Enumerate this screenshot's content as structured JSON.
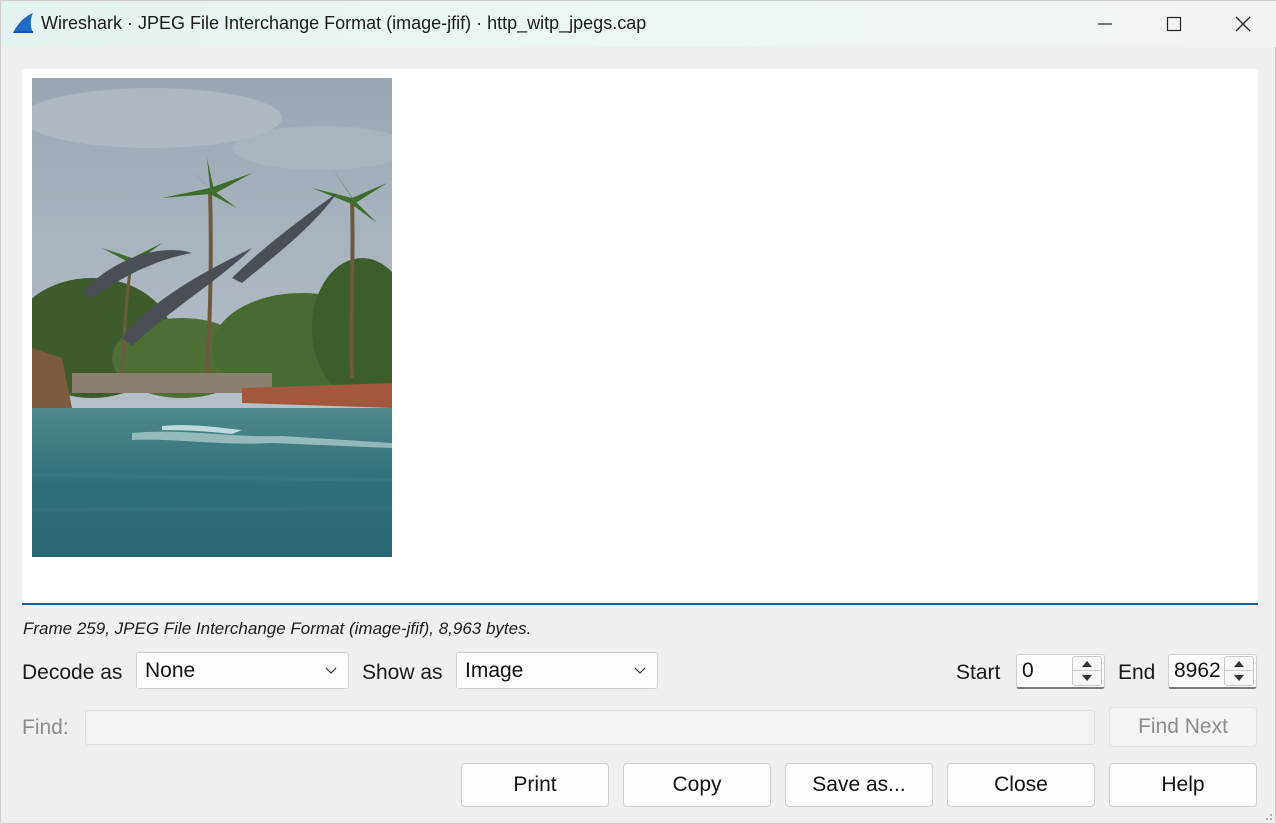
{
  "window": {
    "title": "Wireshark · JPEG File Interchange Format (image-jfif) · http_witp_jpegs.cap",
    "icon": "wireshark-fin-icon",
    "controls": [
      "minimize-icon",
      "maximize-icon",
      "close-icon"
    ]
  },
  "viewer": {
    "content": "jpeg-image"
  },
  "frame_info": "Frame 259, JPEG File Interchange Format (image-jfif), 8,963 bytes.",
  "decode_as": {
    "label": "Decode as",
    "value": "None"
  },
  "show_as": {
    "label": "Show as",
    "value": "Image"
  },
  "start": {
    "label": "Start",
    "value": "0"
  },
  "end": {
    "label": "End",
    "value": "8962"
  },
  "find": {
    "label": "Find:",
    "value": "",
    "button": "Find Next"
  },
  "buttons": {
    "print": "Print",
    "copy": "Copy",
    "save_as": "Save as...",
    "close": "Close",
    "help": "Help"
  },
  "colors": {
    "accent": "#1f5f9e",
    "title_bar": "#e6f3f3"
  }
}
